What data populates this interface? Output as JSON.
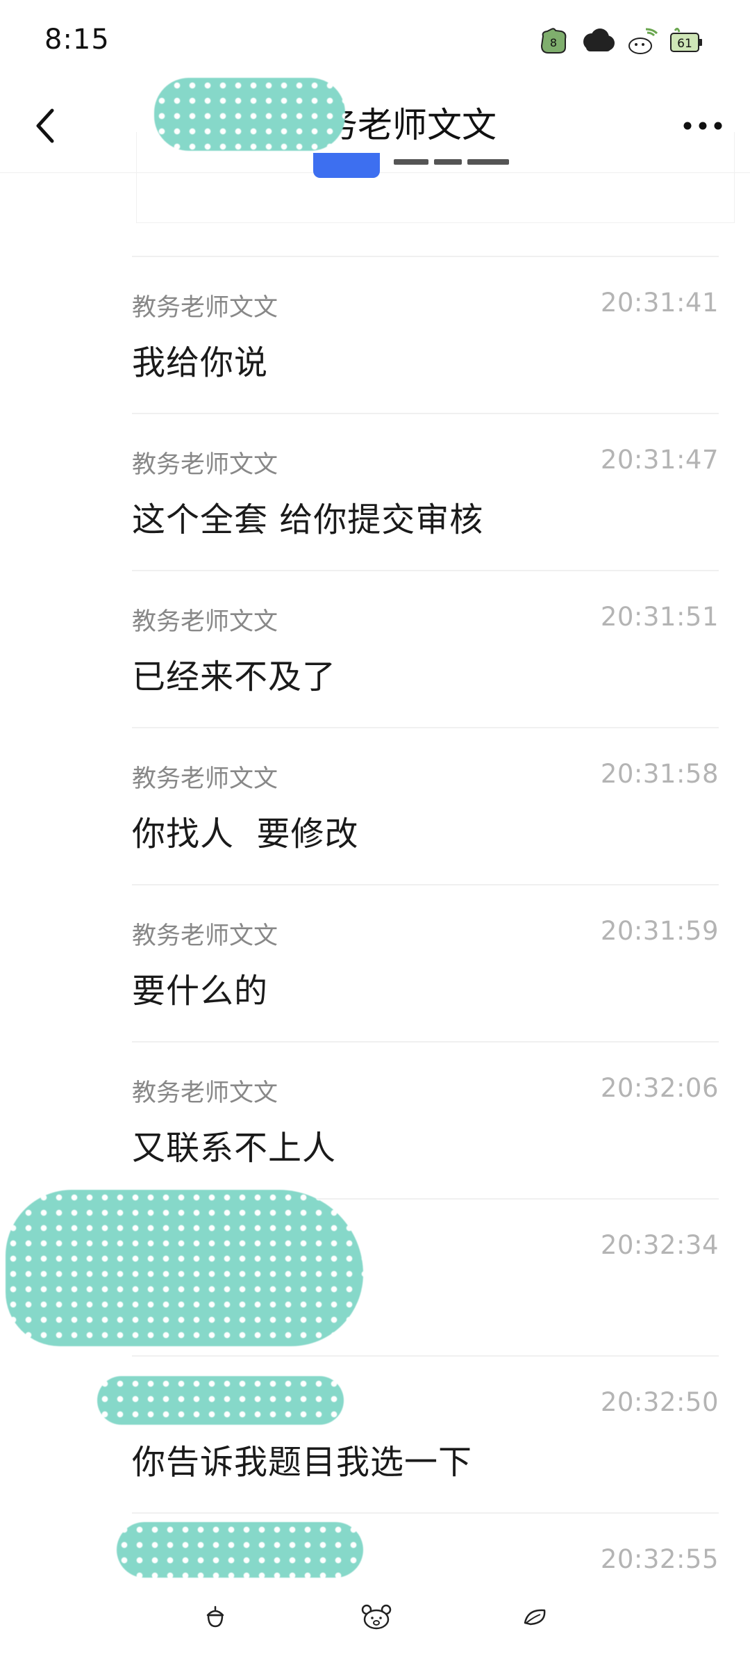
{
  "status_bar": {
    "time": "8:15",
    "battery_level": "61",
    "icons": [
      "wallet-icon",
      "cloud-icon",
      "wifi-sheep-icon",
      "battery-icon"
    ]
  },
  "header": {
    "title": "教务老师文文",
    "back_icon": "chevron-left-icon",
    "more_icon": "more-icon"
  },
  "messages": [
    {
      "sender": "教务老师文文",
      "time": "20:31:41",
      "content": "我给你说"
    },
    {
      "sender": "教务老师文文",
      "time": "20:31:47",
      "content": "这个全套 给你提交审核"
    },
    {
      "sender": "教务老师文文",
      "time": "20:31:51",
      "content": "已经来不及了"
    },
    {
      "sender": "教务老师文文",
      "time": "20:31:58",
      "content": "你找人  要修改"
    },
    {
      "sender": "教务老师文文",
      "time": "20:31:59",
      "content": "要什么的"
    },
    {
      "sender": "教务老师文文",
      "time": "20:32:06",
      "content": "又联系不上人"
    },
    {
      "sender": "",
      "time": "20:32:34",
      "content": ""
    },
    {
      "sender": "",
      "time": "20:32:50",
      "content": "你告诉我题目我选一下"
    },
    {
      "sender": "",
      "time": "20:32:55",
      "content": ""
    }
  ],
  "bottom_bar": {
    "icons": [
      "acorn-icon",
      "bear-face-icon",
      "leaf-icon"
    ]
  },
  "colors": {
    "redaction": "#86d8c9",
    "sender_text": "#888888",
    "time_text": "#b4b4b4",
    "content_text": "#1a1a1a"
  }
}
